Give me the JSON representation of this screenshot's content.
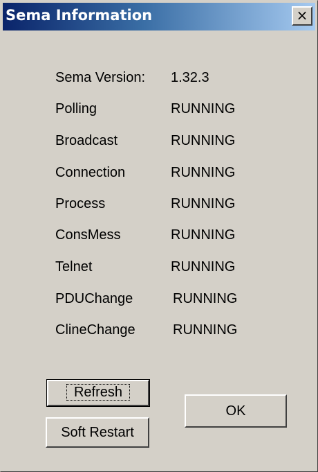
{
  "window": {
    "title": "Sema Information",
    "close_label": "×"
  },
  "info": {
    "version_label": "Sema Version:",
    "version_value": "1.32.3",
    "rows": [
      {
        "label": "Polling",
        "status": "RUNNING"
      },
      {
        "label": "Broadcast",
        "status": "RUNNING"
      },
      {
        "label": "Connection",
        "status": "RUNNING"
      },
      {
        "label": "Process",
        "status": "RUNNING"
      },
      {
        "label": "ConsMess",
        "status": "RUNNING"
      },
      {
        "label": "Telnet",
        "status": "RUNNING"
      },
      {
        "label": "PDUChange",
        "status": "RUNNING"
      },
      {
        "label": "ClineChange",
        "status": "RUNNING"
      }
    ]
  },
  "buttons": {
    "refresh": "Refresh",
    "soft_restart": "Soft Restart",
    "ok": "OK"
  }
}
